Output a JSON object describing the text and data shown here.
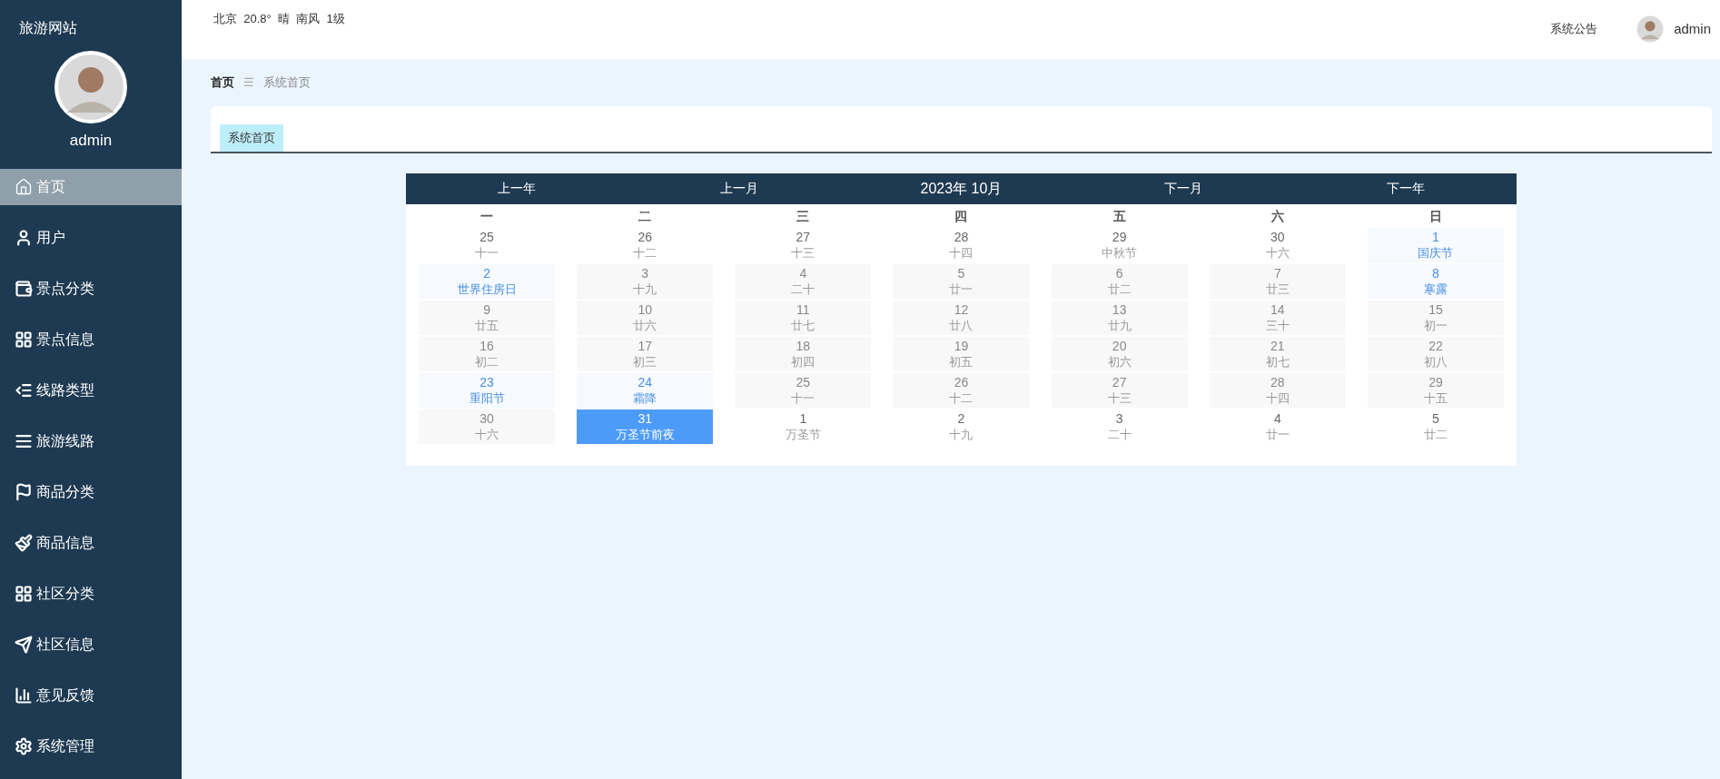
{
  "sidebar": {
    "title": "旅游网站",
    "user": "admin",
    "items": [
      {
        "label": "首页",
        "selected": true
      },
      {
        "label": "用户",
        "selected": false
      },
      {
        "label": "景点分类",
        "selected": false
      },
      {
        "label": "景点信息",
        "selected": false
      },
      {
        "label": "线路类型",
        "selected": false
      },
      {
        "label": "旅游线路",
        "selected": false
      },
      {
        "label": "商品分类",
        "selected": false
      },
      {
        "label": "商品信息",
        "selected": false
      },
      {
        "label": "社区分类",
        "selected": false
      },
      {
        "label": "社区信息",
        "selected": false
      },
      {
        "label": "意见反馈",
        "selected": false
      },
      {
        "label": "系统管理",
        "selected": false
      }
    ]
  },
  "topbar": {
    "weather": "北京  20.8°  晴  南风  1级",
    "notice": "系统公告",
    "user": "admin"
  },
  "breadcrumb": {
    "home": "首页",
    "separator": "☰",
    "current": "系统首页"
  },
  "tabs": [
    {
      "label": "系统首页",
      "selected": true
    }
  ],
  "calendar": {
    "nav": [
      "上一年",
      "上一月"
    ],
    "title": "2023年 10月",
    "nav_right": [
      "下一月",
      "下一年"
    ],
    "weekdays": [
      "一",
      "二",
      "三",
      "四",
      "五",
      "六",
      "日"
    ],
    "weeks": [
      [
        {
          "day": "25",
          "note": "十一",
          "kind": "plain"
        },
        {
          "day": "26",
          "note": "十二",
          "kind": "plain"
        },
        {
          "day": "27",
          "note": "十三",
          "kind": "plain"
        },
        {
          "day": "28",
          "note": "十四",
          "kind": "plain"
        },
        {
          "day": "29",
          "note": "中秋节",
          "kind": "plain"
        },
        {
          "day": "30",
          "note": "十六",
          "kind": "plain"
        },
        {
          "day": "1",
          "note": "国庆节",
          "kind": "holiday"
        }
      ],
      [
        {
          "day": "2",
          "note": "世界住房日",
          "kind": "holiday"
        },
        {
          "day": "3",
          "note": "十九",
          "kind": "shaded"
        },
        {
          "day": "4",
          "note": "二十",
          "kind": "shaded"
        },
        {
          "day": "5",
          "note": "廿一",
          "kind": "shaded"
        },
        {
          "day": "6",
          "note": "廿二",
          "kind": "shaded"
        },
        {
          "day": "7",
          "note": "廿三",
          "kind": "shaded"
        },
        {
          "day": "8",
          "note": "寒露",
          "kind": "holiday"
        }
      ],
      [
        {
          "day": "9",
          "note": "廿五",
          "kind": "shaded"
        },
        {
          "day": "10",
          "note": "廿六",
          "kind": "shaded"
        },
        {
          "day": "11",
          "note": "廿七",
          "kind": "shaded"
        },
        {
          "day": "12",
          "note": "廿八",
          "kind": "shaded"
        },
        {
          "day": "13",
          "note": "廿九",
          "kind": "shaded"
        },
        {
          "day": "14",
          "note": "三十",
          "kind": "shaded"
        },
        {
          "day": "15",
          "note": "初一",
          "kind": "shaded"
        }
      ],
      [
        {
          "day": "16",
          "note": "初二",
          "kind": "shaded"
        },
        {
          "day": "17",
          "note": "初三",
          "kind": "shaded"
        },
        {
          "day": "18",
          "note": "初四",
          "kind": "shaded"
        },
        {
          "day": "19",
          "note": "初五",
          "kind": "shaded"
        },
        {
          "day": "20",
          "note": "初六",
          "kind": "shaded"
        },
        {
          "day": "21",
          "note": "初七",
          "kind": "shaded"
        },
        {
          "day": "22",
          "note": "初八",
          "kind": "shaded"
        }
      ],
      [
        {
          "day": "23",
          "note": "重阳节",
          "kind": "holiday"
        },
        {
          "day": "24",
          "note": "霜降",
          "kind": "holiday"
        },
        {
          "day": "25",
          "note": "十一",
          "kind": "shaded"
        },
        {
          "day": "26",
          "note": "十二",
          "kind": "shaded"
        },
        {
          "day": "27",
          "note": "十三",
          "kind": "shaded"
        },
        {
          "day": "28",
          "note": "十四",
          "kind": "shaded"
        },
        {
          "day": "29",
          "note": "十五",
          "kind": "shaded"
        }
      ],
      [
        {
          "day": "30",
          "note": "十六",
          "kind": "shaded"
        },
        {
          "day": "31",
          "note": "万圣节前夜",
          "kind": "today"
        },
        {
          "day": "1",
          "note": "万圣节",
          "kind": "plain"
        },
        {
          "day": "2",
          "note": "十九",
          "kind": "plain"
        },
        {
          "day": "3",
          "note": "二十",
          "kind": "plain"
        },
        {
          "day": "4",
          "note": "廿一",
          "kind": "plain"
        },
        {
          "day": "5",
          "note": "廿二",
          "kind": "plain"
        }
      ]
    ]
  }
}
